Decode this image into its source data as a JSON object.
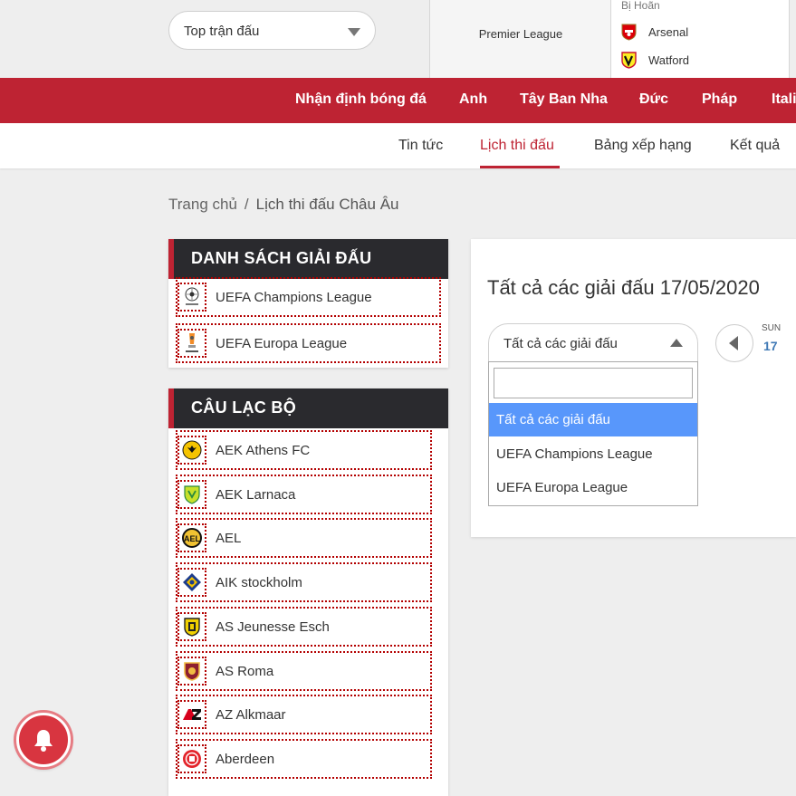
{
  "top": {
    "select_label": "Top trận đấu",
    "league": "Premier League",
    "status": "Bị Hoãn",
    "teams": [
      {
        "name": "Arsenal",
        "icon": "arsenal-crest-icon"
      },
      {
        "name": "Watford",
        "icon": "watford-crest-icon"
      }
    ]
  },
  "nav": {
    "items": [
      "Nhận định bóng đá",
      "Anh",
      "Tây Ban Nha",
      "Đức",
      "Pháp",
      "Itali"
    ]
  },
  "subnav": {
    "items": [
      "Tin tức",
      "Lịch thi đấu",
      "Bảng xếp hạng",
      "Kết quả"
    ],
    "active": "Lịch thi đấu"
  },
  "breadcrumb": {
    "home": "Trang chủ",
    "separator": "/",
    "current": "Lịch thi đấu Châu Âu"
  },
  "competitions": {
    "title": "DANH SÁCH GIẢI ĐẤU",
    "items": [
      {
        "name": "UEFA Champions League",
        "icon": "champions-league-logo-icon"
      },
      {
        "name": "UEFA Europa League",
        "icon": "europa-league-logo-icon"
      }
    ]
  },
  "clubs": {
    "title": "CÂU LẠC BỘ",
    "items": [
      {
        "name": "AEK Athens FC",
        "icon": "aek-athens-crest-icon"
      },
      {
        "name": "AEK Larnaca",
        "icon": "aek-larnaca-crest-icon"
      },
      {
        "name": "AEL",
        "icon": "ael-crest-icon"
      },
      {
        "name": "AIK stockholm",
        "icon": "aik-crest-icon"
      },
      {
        "name": "AS Jeunesse Esch",
        "icon": "jeunesse-esch-crest-icon"
      },
      {
        "name": "AS Roma",
        "icon": "roma-crest-icon"
      },
      {
        "name": "AZ Alkmaar",
        "icon": "az-alkmaar-crest-icon"
      },
      {
        "name": "Aberdeen",
        "icon": "aberdeen-crest-icon"
      }
    ]
  },
  "main": {
    "title": "Tất cả các giải đấu 17/05/2020",
    "select_label": "Tất cả các giải đấu",
    "search_value": "",
    "options": [
      "Tất cả các giải đấu",
      "UEFA Champions League",
      "UEFA Europa League"
    ],
    "selected_option": "Tất cả các giải đấu",
    "day_name": "SUN",
    "day_num": "17"
  },
  "colors": {
    "brand_red": "#be2333",
    "header_dark": "#2a2a2e",
    "option_highlight": "#5897fb",
    "date_blue": "#3f79b5"
  }
}
